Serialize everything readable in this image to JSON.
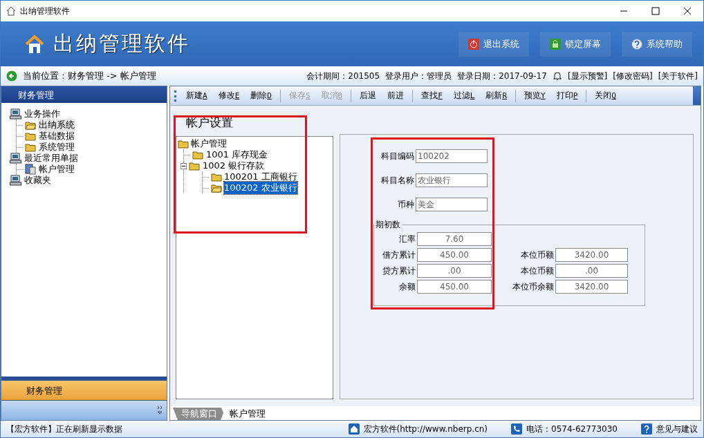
{
  "window": {
    "title": "出纳管理软件"
  },
  "banner": {
    "title": "出纳管理软件",
    "buttons": [
      {
        "label": "退出系统",
        "kind": "exit"
      },
      {
        "label": "锁定屏幕",
        "kind": "lock"
      },
      {
        "label": "系统帮助",
        "kind": "help"
      }
    ]
  },
  "location": {
    "breadcrumb": "当前位置：财务管理 -> 帐户管理",
    "info": [
      "会计期间：201505",
      "登录用户：管理员",
      "登录日期：2017-09-17"
    ],
    "links": [
      "[显示预警]",
      "[修改密码]",
      "[关于软件]"
    ]
  },
  "sidebar": {
    "header": "财务管理",
    "items": [
      {
        "label": "业务操作",
        "kind": "computer",
        "children": [
          {
            "label": "出纳系统",
            "kind": "folder-open",
            "selected": true
          },
          {
            "label": "基础数据",
            "kind": "folder",
            "selected": false
          },
          {
            "label": "系统管理",
            "kind": "folder",
            "selected": false
          }
        ]
      },
      {
        "label": "最近常用单据",
        "kind": "computer",
        "children": [
          {
            "label": "帐户管理",
            "kind": "document",
            "selected": false
          }
        ]
      },
      {
        "label": "收藏夹",
        "kind": "computer"
      }
    ],
    "footer": "财务管理"
  },
  "toolbar": {
    "groups": [
      [
        {
          "label": "新建",
          "shortcut": "A",
          "disabled": false
        },
        {
          "label": "修改",
          "shortcut": "E",
          "disabled": false
        },
        {
          "label": "删除",
          "shortcut": "D",
          "disabled": false
        }
      ],
      [
        {
          "label": "保存",
          "shortcut": "S",
          "disabled": true
        },
        {
          "label": "取消",
          "shortcut": "B",
          "disabled": true
        }
      ],
      [
        {
          "label": "后退",
          "disabled": false
        },
        {
          "label": "前进",
          "disabled": false
        }
      ],
      [
        {
          "label": "查找",
          "shortcut": "F",
          "disabled": false
        },
        {
          "label": "过滤",
          "shortcut": "L",
          "disabled": false
        },
        {
          "label": "刷新",
          "shortcut": "R",
          "disabled": false
        }
      ],
      [
        {
          "label": "预览",
          "shortcut": "Y",
          "disabled": false
        },
        {
          "label": "打印",
          "shortcut": "P",
          "disabled": false
        }
      ],
      [
        {
          "label": "关闭",
          "shortcut": "Q",
          "disabled": false
        }
      ]
    ]
  },
  "panel": {
    "title": "帐户设置",
    "account_tree": {
      "label": "帐户管理",
      "children": [
        {
          "code": "1001",
          "name": "库存现金",
          "selected": false
        },
        {
          "code": "1002",
          "name": "银行存款",
          "expanded": true,
          "selected": false,
          "children": [
            {
              "code": "100201",
              "name": "工商银行",
              "selected": false
            },
            {
              "code": "100202",
              "name": "农业银行",
              "selected": true
            }
          ]
        }
      ]
    },
    "fields": [
      {
        "label": "科目编码",
        "value": "100202"
      },
      {
        "label": "科目名称",
        "value": "农业银行"
      },
      {
        "label": "币种",
        "value": "美金"
      }
    ],
    "opening": {
      "title": "期初数",
      "rows": [
        {
          "label": "汇率",
          "value": "7.60"
        },
        {
          "label": "借方累计",
          "value": "450.00",
          "local_label": "本位币额",
          "local_value": "3420.00"
        },
        {
          "label": "贷方累计",
          "value": ".00",
          "local_label": "本位币额",
          "local_value": ".00"
        },
        {
          "label": "余额",
          "value": "450.00",
          "local_label": "本位币余额",
          "local_value": "3420.00"
        }
      ]
    }
  },
  "tabs": [
    {
      "label": "导航窗口",
      "selected": false
    },
    {
      "label": "帐户管理",
      "selected": true
    }
  ],
  "status_bar": {
    "message": "【宏方软件】正在刷新显示数据",
    "items": [
      {
        "label": "宏方软件(http://www.nberp.cn)",
        "kind": "home"
      },
      {
        "label": "电话：0574-62773030",
        "kind": "phone"
      },
      {
        "label": "意见与建议",
        "kind": "help"
      }
    ]
  }
}
